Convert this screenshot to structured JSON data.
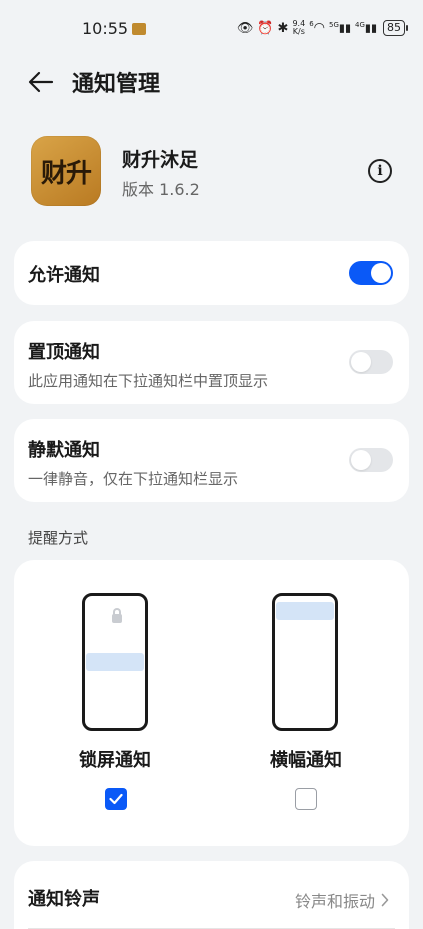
{
  "status_bar": {
    "time": "10:55",
    "net_speed_value": "9.4",
    "net_speed_unit": "K/s",
    "wifi_badge": "6",
    "sim1_label": "5G",
    "sim2_label": "4G",
    "battery": "85"
  },
  "header": {
    "title": "通知管理"
  },
  "app": {
    "logo_text": "财升",
    "name": "财升沐足",
    "version": "版本 1.6.2",
    "info_icon": "i"
  },
  "settings": {
    "allow": {
      "title": "允许通知",
      "enabled": true
    },
    "pin_top": {
      "title": "置顶通知",
      "subtitle": "此应用通知在下拉通知栏中置顶显示",
      "enabled": false
    },
    "silent": {
      "title": "静默通知",
      "subtitle": "一律静音，仅在下拉通知栏显示",
      "enabled": false
    }
  },
  "reminder": {
    "section_label": "提醒方式",
    "modes": [
      {
        "label": "锁屏通知",
        "checked": true
      },
      {
        "label": "横幅通知",
        "checked": false
      }
    ]
  },
  "ringtone": {
    "title": "通知铃声",
    "value": "铃声和振动"
  },
  "colors": {
    "accent": "#0a59f7",
    "background": "#f1f3f5",
    "card": "#ffffff",
    "banner": "#d4e4f7"
  }
}
